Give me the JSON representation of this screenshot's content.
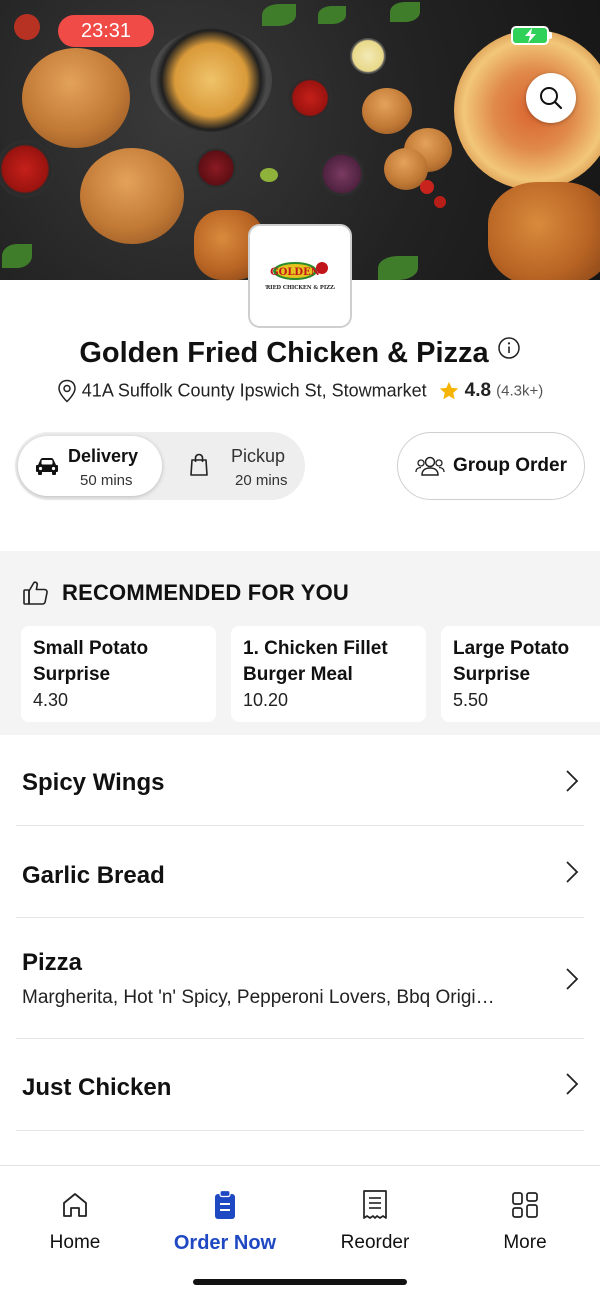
{
  "status_bar": {
    "time": "23:31"
  },
  "store": {
    "name": "Golden Fried Chicken & Pizza",
    "address": "41A Suffolk County Ipswich St, Stowmarket",
    "rating": "4.8",
    "rating_count": "(4.3k+)",
    "logo_title": "GOLDEN",
    "logo_subtitle": "FRIED CHICKEN & PIZZA"
  },
  "order_modes": {
    "delivery": {
      "label": "Delivery",
      "time": "50 mins",
      "selected": true
    },
    "pickup": {
      "label": "Pickup",
      "time": "20 mins",
      "selected": false
    }
  },
  "group_order": {
    "label": "Group Order"
  },
  "recommended": {
    "title": "RECOMMENDED FOR YOU",
    "items": [
      {
        "name": "Small Potato Surprise",
        "price": "4.30"
      },
      {
        "name": "1. Chicken Fillet Burger Meal",
        "price": "10.20"
      },
      {
        "name": "Large Potato Surprise",
        "price": "5.50"
      }
    ]
  },
  "categories": [
    {
      "name": "Spicy Wings",
      "description": ""
    },
    {
      "name": "Garlic Bread",
      "description": ""
    },
    {
      "name": "Pizza",
      "description": "Margherita, Hot 'n' Spicy, Pepperoni Lovers, Bbq Origi…"
    },
    {
      "name": "Just Chicken",
      "description": ""
    }
  ],
  "tabs": [
    {
      "label": "Home",
      "icon": "home-icon",
      "active": false
    },
    {
      "label": "Order Now",
      "icon": "order-icon",
      "active": true
    },
    {
      "label": "Reorder",
      "icon": "receipt-icon",
      "active": false
    },
    {
      "label": "More",
      "icon": "grid-icon",
      "active": false
    }
  ],
  "colors": {
    "accent": "#1f49c2",
    "time_pill": "#f04b47",
    "rating_star": "#f5b400",
    "battery": "#2fd158"
  }
}
